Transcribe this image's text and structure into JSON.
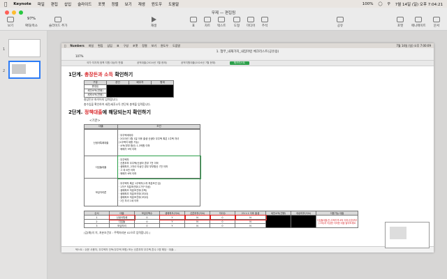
{
  "menubar": {
    "apple": "",
    "app": "Keynote",
    "items": [
      "파일",
      "편집",
      "삽입",
      "슬라이드",
      "포맷",
      "정렬",
      "보기",
      "재생",
      "윈도우",
      "도움말"
    ],
    "battery": "100%",
    "datetime": "7월 14일 (일) 오후 7:04:21"
  },
  "window": {
    "title": "무제 — 편집됨"
  },
  "toolbar": {
    "left": [
      {
        "label": "보기"
      },
      {
        "label": "확대/축소",
        "value": "97%"
      },
      {
        "label": "슬라이드 추가"
      }
    ],
    "center": [
      {
        "label": "재생"
      },
      {
        "label": "표"
      },
      {
        "label": "차트"
      },
      {
        "label": "텍스트"
      },
      {
        "label": "도형"
      },
      {
        "label": "미디어"
      },
      {
        "label": "주석"
      }
    ],
    "right": [
      {
        "label": "공유"
      },
      {
        "label": "포맷"
      },
      {
        "label": "애니메이트"
      },
      {
        "label": "문서"
      }
    ]
  },
  "sidebar": {
    "slides": [
      "1",
      "2"
    ]
  },
  "inner": {
    "menubar": [
      "Numbers",
      "파일",
      "편집",
      "삽입",
      "표",
      "구성",
      "포맷",
      "정렬",
      "보기",
      "윈도우",
      "도움말"
    ],
    "datetime": "7월 14일 (일) 오후 7:00:09",
    "title": "1. 험부_내재가치_내집마련 체크리스트(공유용)",
    "zoom": "107%",
    "tabs": [
      "국가·지자체 정책 지원 대상자 판별",
      "공적대출(2024년 7월 현재)",
      "공적지원대출(2024년 7월 현재)",
      "체크리스트"
    ],
    "active_tab": "체크리스트",
    "status": "텍스트 : 쉬운 사용자, 무주택자 단독(무주택 포함) 또는 신혼부부 무주택 혼수 1명 해당 · 대출..."
  },
  "sheet": {
    "step1": {
      "pre": "1단계. ",
      "red": "총장돈과 소득",
      "post": " 확인하기"
    },
    "table1": {
      "headers": [
        "구분",
        "본인",
        "배우자",
        "합계"
      ],
      "rows": [
        "총장돈",
        "세전소득(연봉)",
        "세후소득(연봉)"
      ]
    },
    "note1": "총장돈은 파이어의 입력합니다.",
    "note2": "총수입을 확인하여 세전/세후소득 연단위 총액을 입력합니다.",
    "step2": {
      "pre": "2단계. ",
      "red": "정책대출",
      "post": "에 해당되는지 확인하기"
    },
    "criteria_label": "<기준>",
    "cond_headers": [
      "대출",
      "조건"
    ],
    "conds": [
      {
        "name": "신생아특례대출",
        "lines": [
          "· 무주택세대주",
          "· 2023년 1월 1일 이후 출생 신생아 무주택 혹은 1주택 자녀",
          "  (1주택자 대환 가능)",
          "· 소득(부부 합산) 1.3억원 이하",
          "· 매매가 9억 이하"
        ]
      },
      {
        "name": "디딤돌대출",
        "lines": [
          "· 무주택자",
          "· 신혼부부 무주택(신생아 혼부 7천 이하",
          "· 생애최초, 2자녀 이상인 경우 부부합산 7천 이하",
          "· 그 외 6천 이하",
          "· 매매가 6억 이하"
        ]
      },
      {
        "name": "보금자리론",
        "lines": [
          "· 무주택자 혹은 1주택자(1개 처분조건 입)",
          "· 1가구 처분조건부(1가구 이상)",
          "· 생애최초 처분조건부(주택)",
          "· 생애최초 처분조건부(3자녀)",
          "· 생애최초 처분조건부(3자녀)",
          "· 1인 자녀 1세 이하"
        ]
      }
    ],
    "sum_headers": [
      "순서",
      "대출",
      "보금주택수",
      "생애최초(Y/N)",
      "신혼부부(Y/N)",
      "자녀수",
      "23.1.1 이후 출생",
      "세전소득(연봉)",
      "대상여부(Y/N)",
      "이용가능 대출"
    ],
    "sum_rows": [
      [
        "1",
        "신생아특례",
        "0",
        "Y",
        "N",
        "0",
        "N",
        "",
        "",
        ""
      ],
      [
        "2",
        "디딤돌",
        "0",
        "Y",
        "N",
        "0",
        "N",
        "",
        "",
        ""
      ],
      [
        "3",
        "보금자리",
        "0",
        "Y",
        "N",
        "0",
        "N",
        "",
        "",
        ""
      ]
    ],
    "result_text": "디딤돌대출(단,주택가격 6억 이하)신혼부부(그외)과 이상한 이러한 대출 알아보세요",
    "bottom_note": "(갑(예)의 치, 처분조건부 : 주택처리분 02으로 입력합니다.)",
    "rownums": [
      "1",
      "2",
      "3",
      "4",
      "5",
      "6",
      "7",
      "8",
      "9",
      "10",
      "11",
      "12",
      "13",
      "14",
      "15",
      "16",
      "17",
      "18",
      "19"
    ]
  },
  "colors": {
    "accent": "#2d7cf6",
    "red": "#d9262a",
    "yellow": "#ffff00",
    "green": "#2c9f4a"
  }
}
